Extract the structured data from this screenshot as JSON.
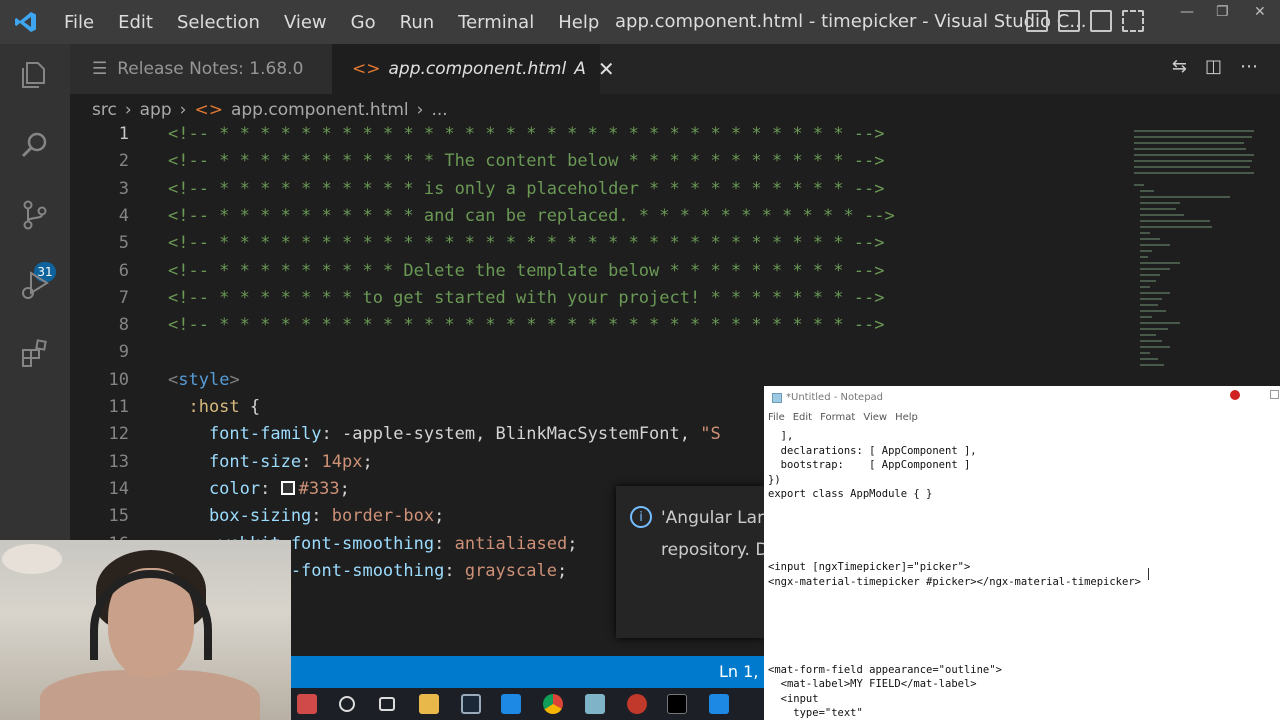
{
  "window": {
    "title": "app.component.html - timepicker - Visual Studio C...",
    "menu": [
      "File",
      "Edit",
      "Selection",
      "View",
      "Go",
      "Run",
      "Terminal",
      "Help"
    ]
  },
  "activity": {
    "source_control_badge": "31"
  },
  "tabs": [
    {
      "label": "Release Notes: 1.68.0",
      "active": false
    },
    {
      "label": "app.component.html",
      "suffix": "A",
      "active": true
    }
  ],
  "breadcrumb": {
    "parts": [
      "src",
      "app",
      "app.component.html",
      "..."
    ]
  },
  "editor": {
    "lines": [
      {
        "n": "1",
        "segments": [
          {
            "t": "<!-- * * * * * * * * * * * * * * * * * * * * * * * * * * * * * * * -->",
            "c": "c-com"
          }
        ]
      },
      {
        "n": "2",
        "segments": [
          {
            "t": "<!-- * * * * * * * * * * * The content below * * * * * * * * * * * -->",
            "c": "c-com"
          }
        ]
      },
      {
        "n": "3",
        "segments": [
          {
            "t": "<!-- * * * * * * * * * * is only a placeholder * * * * * * * * * * -->",
            "c": "c-com"
          }
        ]
      },
      {
        "n": "4",
        "segments": [
          {
            "t": "<!-- * * * * * * * * * * and can be replaced. * * * * * * * * * * * -->",
            "c": "c-com"
          }
        ]
      },
      {
        "n": "5",
        "segments": [
          {
            "t": "<!-- * * * * * * * * * * * * * * * * * * * * * * * * * * * * * * * -->",
            "c": "c-com"
          }
        ]
      },
      {
        "n": "6",
        "segments": [
          {
            "t": "<!-- * * * * * * * * * Delete the template below * * * * * * * * * -->",
            "c": "c-com"
          }
        ]
      },
      {
        "n": "7",
        "segments": [
          {
            "t": "<!-- * * * * * * * to get started with your project! * * * * * * * -->",
            "c": "c-com"
          }
        ]
      },
      {
        "n": "8",
        "segments": [
          {
            "t": "<!-- * * * * * * * * * * * * * * * * * * * * * * * * * * * * * * * -->",
            "c": "c-com"
          }
        ]
      },
      {
        "n": "9",
        "segments": []
      },
      {
        "n": "10",
        "segments": [
          {
            "t": "<",
            "c": "c-punc"
          },
          {
            "t": "style",
            "c": "c-tag"
          },
          {
            "t": ">",
            "c": "c-punc"
          }
        ]
      },
      {
        "n": "11",
        "segments": [
          {
            "t": "  :host ",
            "c": "c-sel"
          },
          {
            "t": "{",
            "c": "c-txt"
          }
        ]
      },
      {
        "n": "12",
        "segments": [
          {
            "t": "    font-family",
            "c": "c-prop"
          },
          {
            "t": ": ",
            "c": "c-txt"
          },
          {
            "t": "-apple-system, BlinkMacSystemFont, ",
            "c": "c-txt"
          },
          {
            "t": "\"S",
            "c": "c-val"
          }
        ]
      },
      {
        "n": "13",
        "segments": [
          {
            "t": "    font-size",
            "c": "c-prop"
          },
          {
            "t": ": ",
            "c": "c-txt"
          },
          {
            "t": "14px",
            "c": "c-val"
          },
          {
            "t": ";",
            "c": "c-txt"
          }
        ]
      },
      {
        "n": "14",
        "segments": [
          {
            "t": "    color",
            "c": "c-prop"
          },
          {
            "t": ": ",
            "c": "c-txt"
          },
          {
            "t": "#333",
            "c": "c-val",
            "swatch": true
          },
          {
            "t": ";",
            "c": "c-txt"
          }
        ]
      },
      {
        "n": "15",
        "segments": [
          {
            "t": "    box-sizing",
            "c": "c-prop"
          },
          {
            "t": ": ",
            "c": "c-txt"
          },
          {
            "t": "border-box",
            "c": "c-val"
          },
          {
            "t": ";",
            "c": "c-txt"
          }
        ]
      },
      {
        "n": "16",
        "segments": [
          {
            "t": "    -webkit-font-smoothing",
            "c": "c-prop"
          },
          {
            "t": ": ",
            "c": "c-txt"
          },
          {
            "t": "antialiased",
            "c": "c-val"
          },
          {
            "t": ";",
            "c": "c-txt"
          }
        ]
      },
      {
        "n": "17",
        "segments": [
          {
            "t": "    -moz-osx-font-smoothing",
            "c": "c-prop"
          },
          {
            "t": ": ",
            "c": "c-txt"
          },
          {
            "t": "grayscale",
            "c": "c-val"
          },
          {
            "t": ";",
            "c": "c-txt"
          }
        ]
      }
    ]
  },
  "notification": {
    "line1": "'Angular Lan",
    "line2": "repository. D"
  },
  "statusbar": {
    "position": "Ln 1, C"
  },
  "notepad": {
    "title": "*Untitled - Notepad",
    "menu": [
      "File",
      "Edit",
      "Format",
      "View",
      "Help"
    ],
    "lines": [
      "  ],",
      "  declarations: [ AppComponent ],",
      "  bootstrap:    [ AppComponent ]",
      "})",
      "export class AppModule { }",
      "",
      "",
      "",
      "",
      "<input [ngxTimepicker]=\"picker\">",
      "<ngx-material-timepicker #picker></ngx-material-timepicker>",
      "",
      "",
      "",
      "",
      "",
      "<mat-form-field appearance=\"outline\">",
      "  <mat-label>MY FIELD</mat-label>",
      "  <input",
      "    type=\"text\""
    ]
  },
  "colors": {
    "accent": "#007acc",
    "comment": "#6a9955",
    "tag": "#569cd6",
    "property": "#9cdcfe",
    "string": "#ce9178"
  }
}
